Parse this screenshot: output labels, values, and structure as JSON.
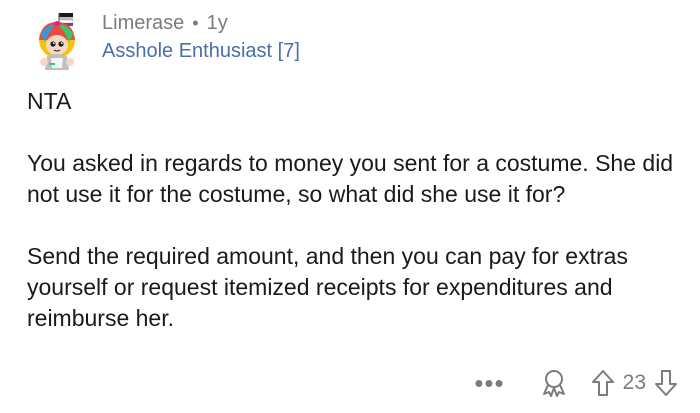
{
  "comment": {
    "username": "Limerase",
    "separator": "•",
    "age": "1y",
    "flair": "Asshole Enthusiast [7]",
    "paragraphs": [
      "NTA",
      "You asked in regards to money you sent for a costume. She did not use it for the costume, so what did she use it for?",
      "Send the required amount, and then you can pay for extras yourself or request itemized receipts for expenditures and reimburse her."
    ]
  },
  "actions": {
    "more": "•••",
    "score": "23"
  },
  "icons": {
    "avatar": "avatar-icon",
    "more": "more-options-icon",
    "award": "award-icon",
    "upvote": "upvote-arrow-icon",
    "downvote": "downvote-arrow-icon"
  },
  "colors": {
    "text": "#1a1a1b",
    "meta": "#7c7c7c",
    "flair": "#4a6fa8"
  }
}
